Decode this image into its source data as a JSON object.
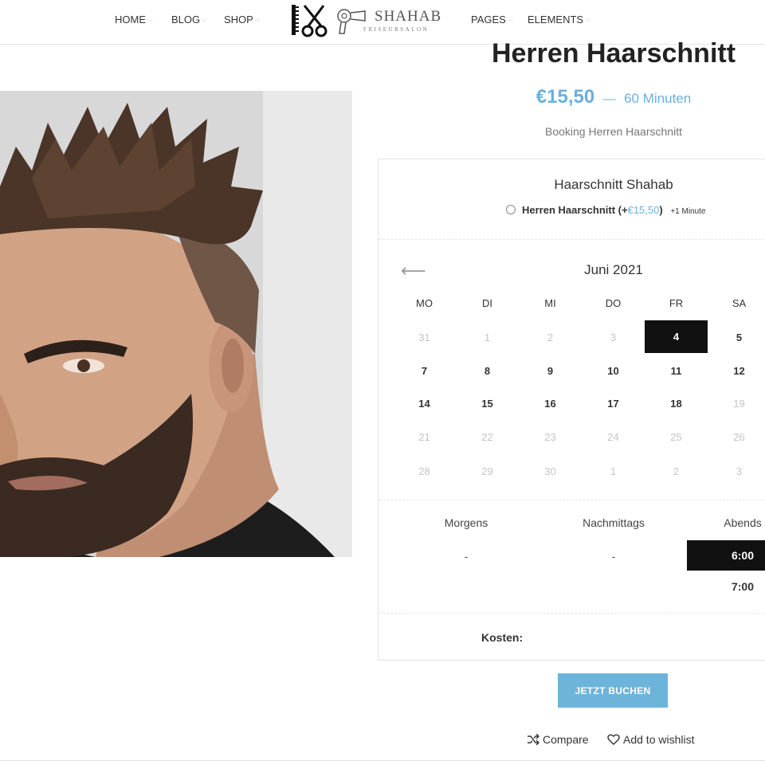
{
  "nav": {
    "left": [
      "HOME",
      "BLOG",
      "SHOP"
    ],
    "right": [
      "PAGES",
      "ELEMENTS"
    ]
  },
  "logo": {
    "name": "SHAHAB",
    "tagline": "FRISEURSALON"
  },
  "product": {
    "title": "Herren Haarschnitt",
    "price": "€15,50",
    "dash": "—",
    "duration": "60 Minuten",
    "booking_label": "Booking Herren Haarschnitt"
  },
  "booking": {
    "staff": "Haarschnitt Shahab",
    "service": {
      "name": "Herren Haarschnitt",
      "price_prefix": "(+",
      "price": "€15,50",
      "price_suffix": ")",
      "extra": "+1 Minute"
    },
    "calendar": {
      "prev_icon": "arrow-left-icon",
      "prev_label": "⟵",
      "month": "Juni 2021",
      "weekdays": [
        "MO",
        "DI",
        "MI",
        "DO",
        "FR",
        "SA"
      ],
      "weeks": [
        [
          "31",
          "1",
          "2",
          "3",
          "4",
          "5"
        ],
        [
          "7",
          "8",
          "9",
          "10",
          "11",
          "12"
        ],
        [
          "14",
          "15",
          "16",
          "17",
          "18",
          "19"
        ],
        [
          "21",
          "22",
          "23",
          "24",
          "25",
          "26"
        ],
        [
          "28",
          "29",
          "30",
          "1",
          "2",
          "3"
        ]
      ],
      "selected": "4"
    },
    "slots": {
      "morning_label": "Morgens",
      "morning_value": "-",
      "afternoon_label": "Nachmittags",
      "afternoon_value": "-",
      "evening_label": "Abends",
      "evening_times": [
        "6:00",
        "7:00"
      ],
      "selected_time": "6:00"
    },
    "cost_label": "Kosten:"
  },
  "actions": {
    "book": "JETZT BUCHEN",
    "compare": "Compare",
    "wishlist": "Add to wishlist"
  },
  "colors": {
    "accent": "#6ab0dc",
    "selected": "#111111"
  }
}
